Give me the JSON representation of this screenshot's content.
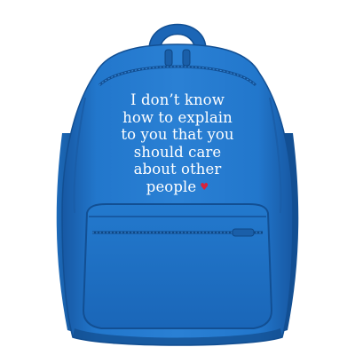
{
  "product": {
    "subject": "blue backpack with printed quote",
    "colors": {
      "fabric": "#1f6fc4",
      "fabric_dark": "#155aa6",
      "fabric_shadow": "#114b8c",
      "fabric_light": "#2c82d6",
      "print": "#ffffff",
      "heart": "#d8233a"
    },
    "print": {
      "lines": [
        "I don’t know",
        "how to explain",
        "to you that you",
        "should care",
        "about other",
        "people"
      ],
      "heart_glyph": "♥"
    }
  }
}
